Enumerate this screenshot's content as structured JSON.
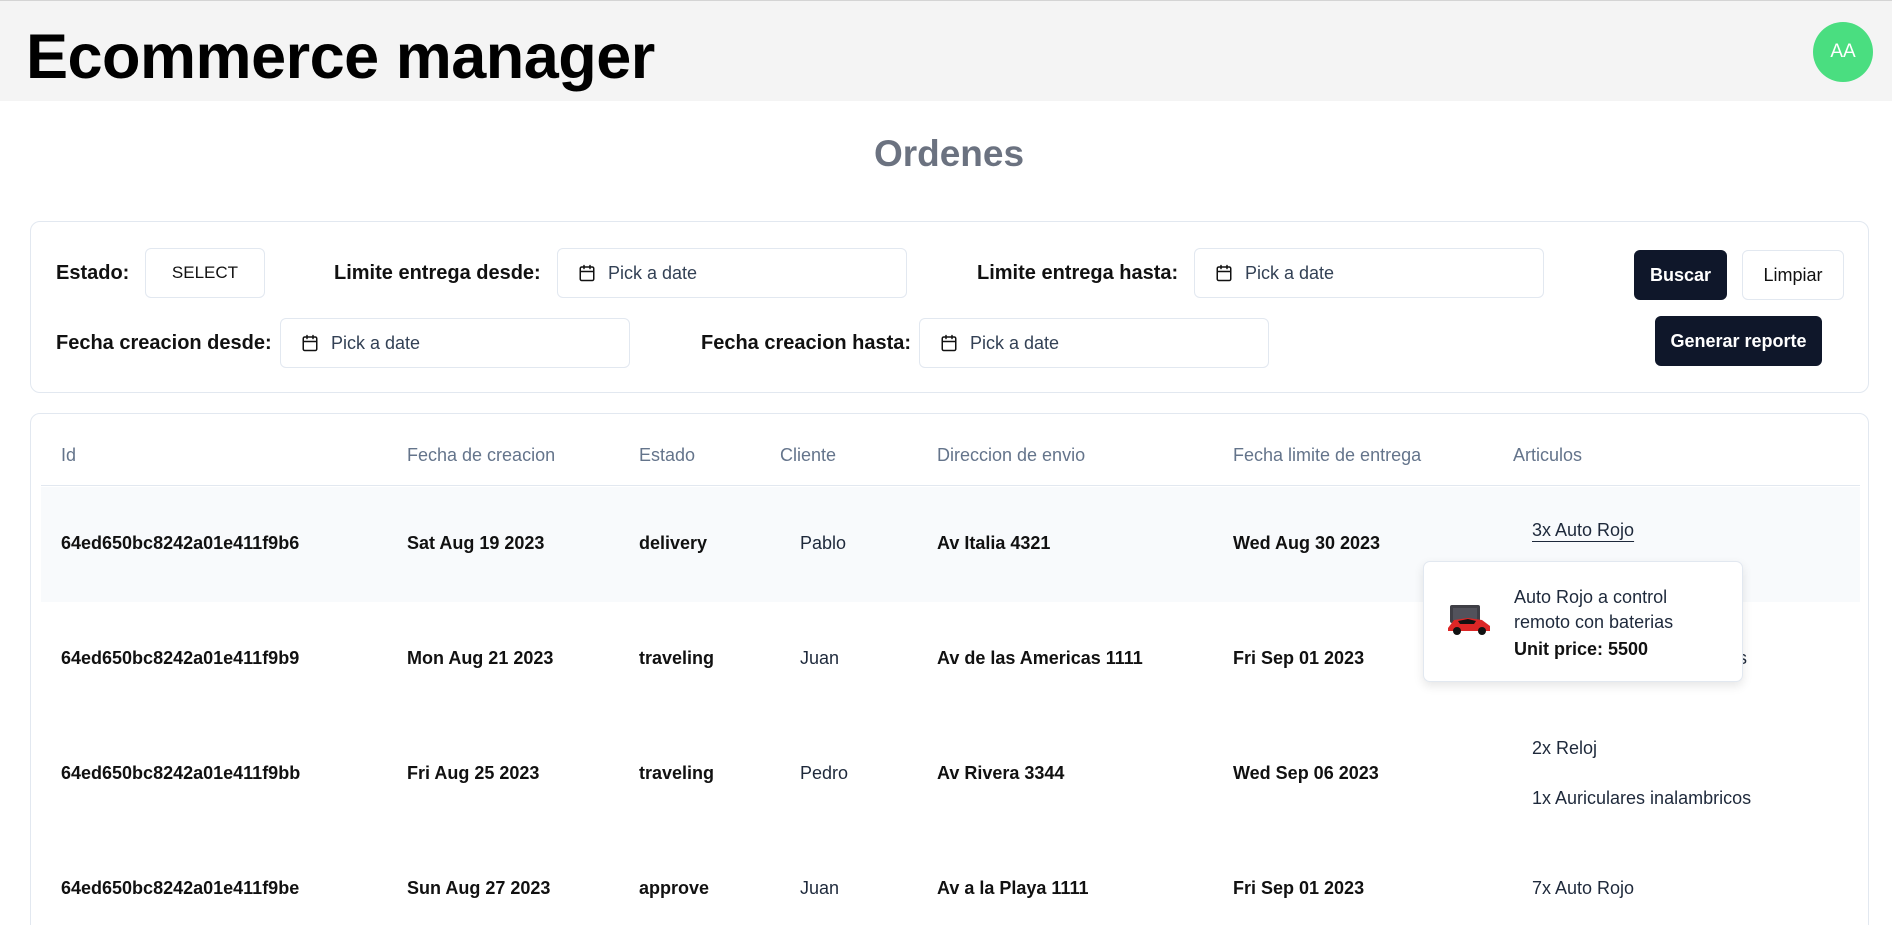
{
  "header": {
    "app_title": "Ecommerce manager",
    "avatar_initials": "AA",
    "avatar_color": "#4ade80"
  },
  "page": {
    "title": "Ordenes"
  },
  "filters": {
    "estado_label": "Estado:",
    "estado_value": "SELECT",
    "limite_desde_label": "Limite entrega desde:",
    "limite_hasta_label": "Limite entrega hasta:",
    "creacion_desde_label": "Fecha creacion desde:",
    "creacion_hasta_label": "Fecha creacion hasta:",
    "date_placeholder": "Pick a date",
    "buscar_label": "Buscar",
    "limpiar_label": "Limpiar",
    "reporte_label": "Generar reporte"
  },
  "table": {
    "columns": [
      "Id",
      "Fecha de creacion",
      "Estado",
      "Cliente",
      "Direccion de envio",
      "Fecha limite de entrega",
      "Articulos"
    ],
    "rows": [
      {
        "id": "64ed650bc8242a01e411f9b6",
        "fecha_creacion": "Sat Aug 19 2023",
        "estado": "delivery",
        "cliente": "Pablo",
        "direccion": "Av Italia 4321",
        "fecha_limite": "Wed Aug 30 2023",
        "articulos": [
          "3x Auto Rojo"
        ]
      },
      {
        "id": "64ed650bc8242a01e411f9b9",
        "fecha_creacion": "Mon Aug 21 2023",
        "estado": "traveling",
        "cliente": "Juan",
        "direccion": "Av de las Americas 1111",
        "fecha_limite": "Fri Sep 01 2023",
        "articulos": [
          "s"
        ]
      },
      {
        "id": "64ed650bc8242a01e411f9bb",
        "fecha_creacion": "Fri Aug 25 2023",
        "estado": "traveling",
        "cliente": "Pedro",
        "direccion": "Av Rivera 3344",
        "fecha_limite": "Wed Sep 06 2023",
        "articulos": [
          "2x Reloj",
          "1x Auriculares inalambricos"
        ]
      },
      {
        "id": "64ed650bc8242a01e411f9be",
        "fecha_creacion": "Sun Aug 27 2023",
        "estado": "approve",
        "cliente": "Juan",
        "direccion": "Av a la Playa 1111",
        "fecha_limite": "Fri Sep 01 2023",
        "articulos": [
          "7x Auto Rojo"
        ]
      }
    ]
  },
  "popover": {
    "product_name": "Auto Rojo a control remoto con baterias",
    "unit_price": "Unit price: 5500"
  }
}
